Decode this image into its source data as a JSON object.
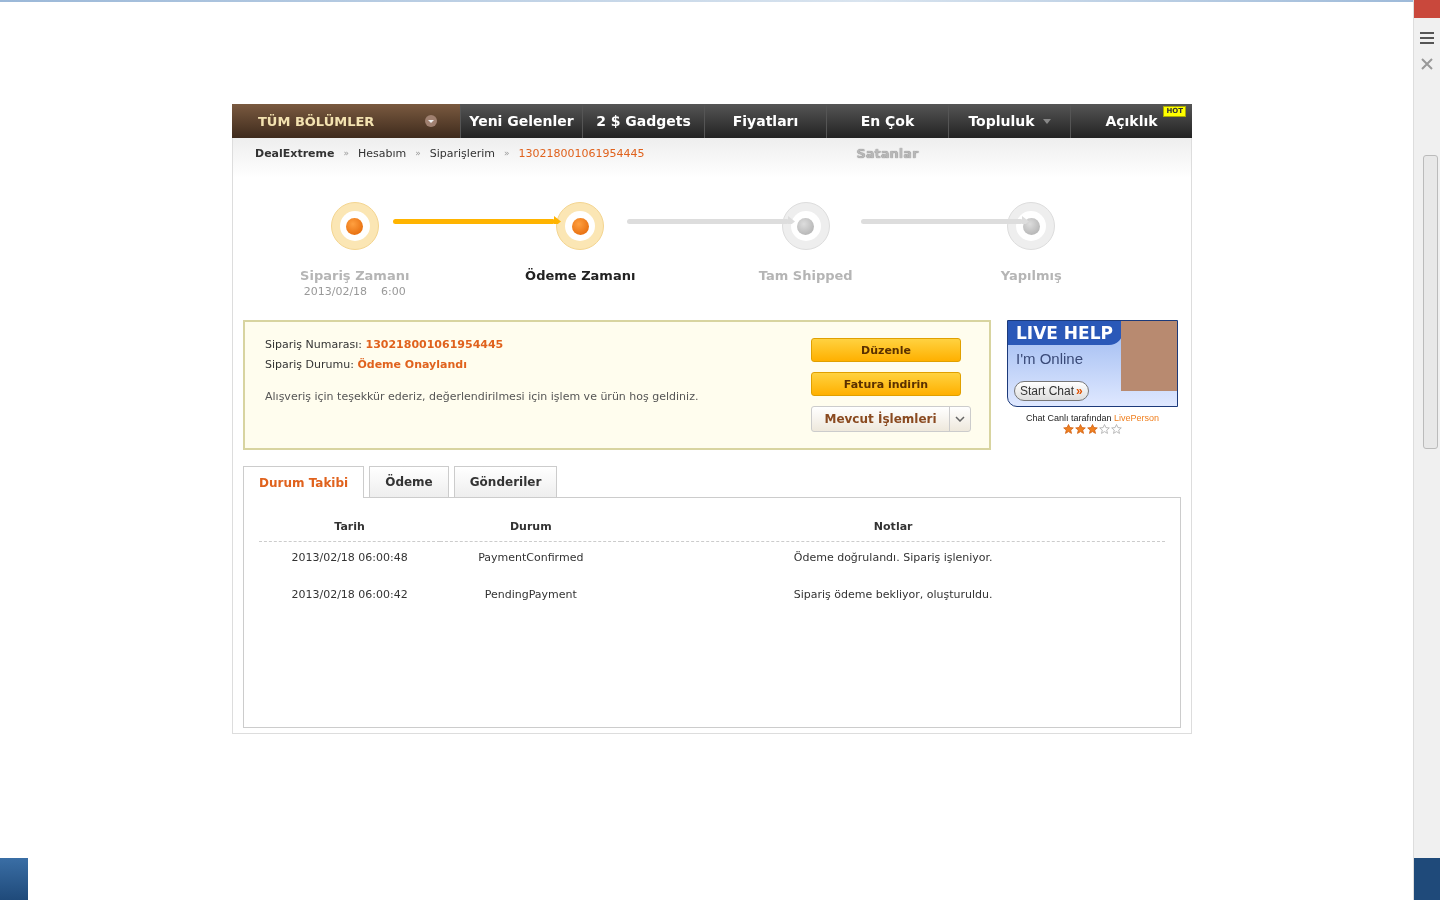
{
  "nav": {
    "all_sections": "TÜM BÖLÜMLER",
    "items": [
      {
        "label": "Yeni Gelenler",
        "dropdown": false
      },
      {
        "label": "2 $ Gadgets",
        "dropdown": false
      },
      {
        "label": "Fiyatları",
        "dropdown": false
      },
      {
        "label": "En Çok",
        "subtitle": "Satanlar",
        "dropdown": false
      },
      {
        "label": "Topluluk",
        "dropdown": true
      },
      {
        "label": "Açıklık",
        "badge": "HOT",
        "dropdown": false
      }
    ]
  },
  "breadcrumb": {
    "separator": "»",
    "items": [
      {
        "label": "DealExtreme",
        "kind": "home"
      },
      {
        "label": "Hesabım",
        "kind": "link"
      },
      {
        "label": "Siparişlerim",
        "kind": "link"
      },
      {
        "label": "130218001061954445",
        "kind": "current"
      }
    ]
  },
  "steps": [
    {
      "label": "Sipariş Zamanı",
      "date": "2013/02/18    6:00",
      "reached": true,
      "current": false
    },
    {
      "label": "Ödeme Zamanı",
      "reached": true,
      "current": true
    },
    {
      "label": "Tam Shipped",
      "reached": false,
      "current": false
    },
    {
      "label": "Yapılmış",
      "reached": false,
      "current": false
    }
  ],
  "order": {
    "number_label": "Sipariş Numarası:",
    "number": "130218001061954445",
    "status_label": "Sipariş Durumu:",
    "status": "Ödeme Onaylandı",
    "message": "Alışveriş için teşekkür ederiz, değerlendirilmesi için işlem ve ürün hoş geldiniz.",
    "buttons": [
      {
        "label": "Düzenle",
        "kind": "primary"
      },
      {
        "label": "Fatura indirin",
        "kind": "primary"
      },
      {
        "label": "Mevcut İşlemleri",
        "kind": "dropdown"
      }
    ]
  },
  "live_help": {
    "title": "LIVE HELP",
    "subtitle": "I'm Online",
    "button": "Start Chat",
    "button_arrow": "»",
    "credit": "Chat Canlı tarafından",
    "brand": "LivePerson",
    "stars": 3
  },
  "tabs": [
    {
      "label": "Durum Takibi",
      "selected": true
    },
    {
      "label": "Ödeme",
      "selected": false
    },
    {
      "label": "Gönderiler",
      "selected": false
    }
  ],
  "table": {
    "columns": [
      "Tarih",
      "Durum",
      "Notlar"
    ],
    "rows": [
      [
        "2013/02/18 06:00:48",
        "PaymentConfirmed",
        "Ödeme doğrulandı. Sipariş işleniyor."
      ],
      [
        "2013/02/18 06:00:42",
        "PendingPayment",
        "Sipariş ödeme bekliyor, oluşturuldu."
      ]
    ]
  }
}
